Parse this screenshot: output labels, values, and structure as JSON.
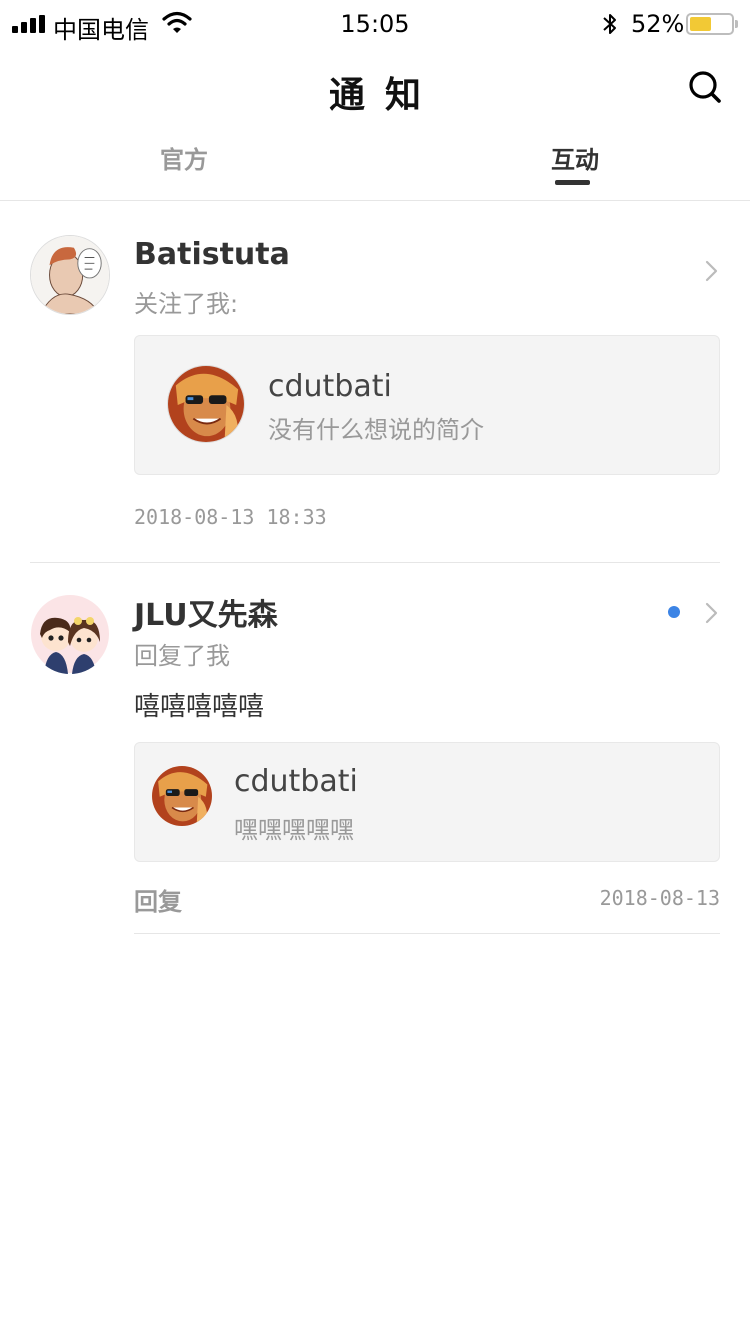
{
  "status_bar": {
    "carrier": "中国电信",
    "time": "15:05",
    "battery_percent": "52%",
    "battery_level": 0.52,
    "battery_color": "#f2c935",
    "icons": [
      "signal-icon",
      "wifi-icon",
      "bluetooth-icon",
      "battery-icon"
    ]
  },
  "nav": {
    "title": "通知",
    "search_icon": "search-icon"
  },
  "tabs": [
    {
      "label": "官方",
      "active": false
    },
    {
      "label": "互动",
      "active": true
    }
  ],
  "notifications": [
    {
      "username": "Batistuta",
      "action": "关注了我:",
      "card": {
        "name": "cdutbati",
        "subtitle": "没有什么想说的简介"
      },
      "time": "2018-08-13 18:33",
      "unread": false
    },
    {
      "username": "JLU又先森",
      "action": "回复了我",
      "comment": "嘻嘻嘻嘻嘻",
      "card": {
        "name": "cdutbati",
        "subtitle": "嘿嘿嘿嘿嘿"
      },
      "reply_label": "回复",
      "time": "2018-08-13",
      "unread": true,
      "unread_color": "#3c84e5"
    }
  ]
}
